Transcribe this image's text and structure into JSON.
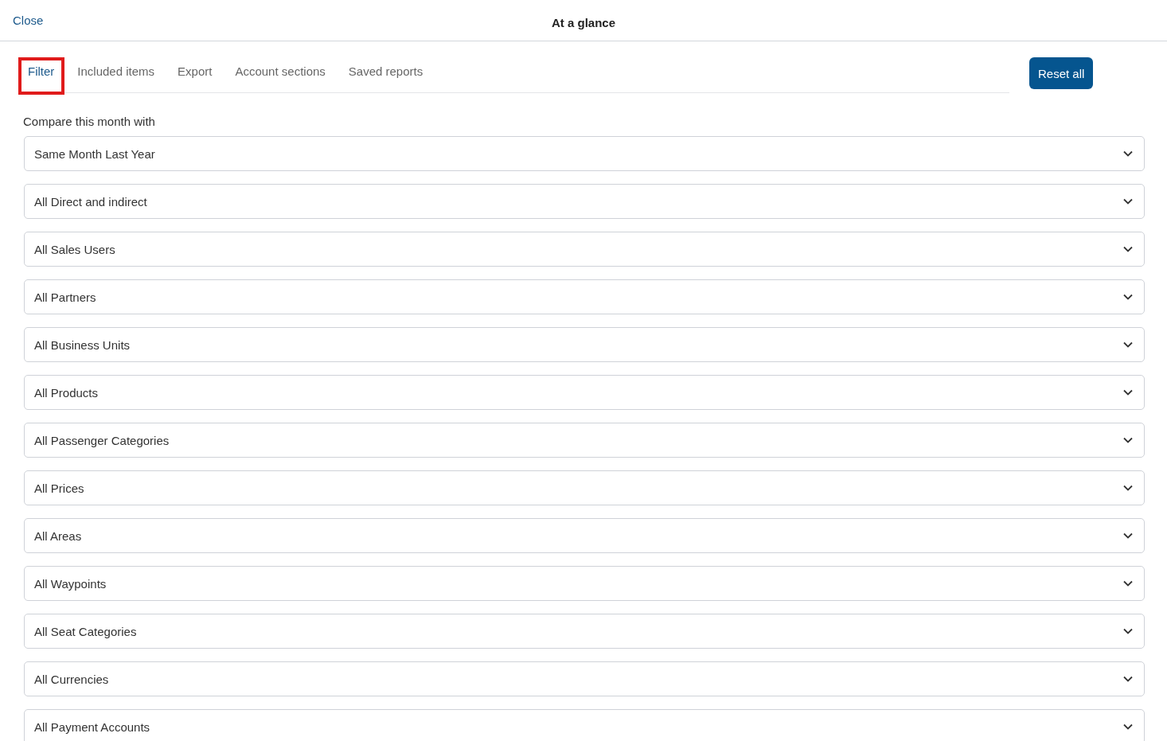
{
  "header": {
    "close": "Close",
    "title": "At a glance"
  },
  "tabs": [
    {
      "label": "Filter",
      "selected": true,
      "highlighted": true
    },
    {
      "label": "Included items",
      "selected": false,
      "highlighted": false
    },
    {
      "label": "Export",
      "selected": false,
      "highlighted": false
    },
    {
      "label": "Account sections",
      "selected": false,
      "highlighted": false
    },
    {
      "label": "Saved reports",
      "selected": false,
      "highlighted": false
    }
  ],
  "reset_button": "Reset all",
  "compare_label": "Compare this month with",
  "dropdowns": [
    "Same Month Last Year",
    "All Direct and indirect",
    "All Sales Users",
    "All Partners",
    "All Business Units",
    "All Products",
    "All Passenger Categories",
    "All Prices",
    "All Areas",
    "All Waypoints",
    "All Seat Categories",
    "All Currencies",
    "All Payment Accounts"
  ]
}
